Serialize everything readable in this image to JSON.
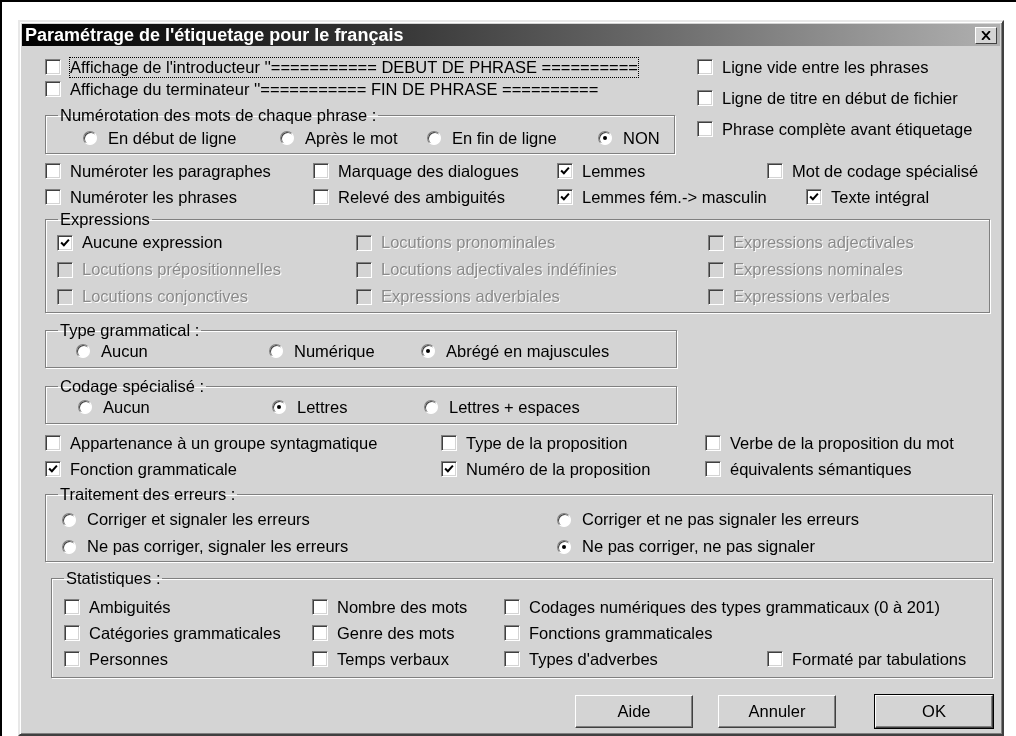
{
  "window": {
    "title": "Paramétrage de l'étiquetage pour le français"
  },
  "display_options": [
    {
      "label": "Affichage de l'introducteur ''=========== DEBUT DE PHRASE ==========",
      "checked": false,
      "focused": true
    },
    {
      "label": "Affichage du terminateur ''=========== FIN DE PHRASE ==========",
      "checked": false,
      "focused": false
    }
  ],
  "word_numbering": {
    "legend": "Numérotation des mots de chaque phrase :",
    "options": [
      {
        "label": "En début de ligne",
        "selected": false
      },
      {
        "label": "Après le mot",
        "selected": false
      },
      {
        "label": "En fin de ligne",
        "selected": false
      },
      {
        "label": "NON",
        "selected": true
      }
    ]
  },
  "file_options": [
    {
      "label": "Ligne vide entre les phrases",
      "checked": false
    },
    {
      "label": "Ligne de titre en début de fichier",
      "checked": false
    },
    {
      "label": "Phrase complète avant étiquetage",
      "checked": false
    }
  ],
  "flags": [
    [
      {
        "label": "Numéroter les paragraphes",
        "checked": false
      },
      {
        "label": "Marquage des dialogues",
        "checked": false
      },
      {
        "label": "Lemmes",
        "checked": true
      },
      {
        "label": "Mot de codage spécialisé",
        "checked": false
      }
    ],
    [
      {
        "label": "Numéroter les phrases",
        "checked": false
      },
      {
        "label": "Relevé des ambiguités",
        "checked": false
      },
      {
        "label": "Lemmes fém.-> masculin",
        "checked": true
      },
      {
        "label": "Texte intégral",
        "checked": true
      }
    ]
  ],
  "expressions": {
    "legend": "Expressions",
    "rows": [
      [
        {
          "label": "Aucune expression",
          "checked": true,
          "disabled": false
        },
        {
          "label": "Locutions pronominales",
          "checked": false,
          "disabled": true
        },
        {
          "label": "Expressions adjectivales",
          "checked": false,
          "disabled": true
        }
      ],
      [
        {
          "label": "Locutions prépositionnelles",
          "checked": false,
          "disabled": true
        },
        {
          "label": "Locutions adjectivales indéfinies",
          "checked": false,
          "disabled": true
        },
        {
          "label": "Expressions nominales",
          "checked": false,
          "disabled": true
        }
      ],
      [
        {
          "label": "Locutions conjonctives",
          "checked": false,
          "disabled": true
        },
        {
          "label": "Expressions adverbiales",
          "checked": false,
          "disabled": true
        },
        {
          "label": "Expressions verbales",
          "checked": false,
          "disabled": true
        }
      ]
    ]
  },
  "grammatical_type": {
    "legend": "Type grammatical :",
    "options": [
      {
        "label": "Aucun",
        "selected": false
      },
      {
        "label": "Numérique",
        "selected": false
      },
      {
        "label": "Abrégé en majuscules",
        "selected": true
      }
    ]
  },
  "special_coding": {
    "legend": "Codage spécialisé :",
    "options": [
      {
        "label": "Aucun",
        "selected": false
      },
      {
        "label": "Lettres",
        "selected": true
      },
      {
        "label": "Lettres + espaces",
        "selected": false
      }
    ]
  },
  "details": [
    [
      {
        "label": "Appartenance à un groupe syntagmatique",
        "checked": false
      },
      {
        "label": "Type de la proposition",
        "checked": false
      },
      {
        "label": "Verbe de la proposition du mot",
        "checked": false
      }
    ],
    [
      {
        "label": "Fonction grammaticale",
        "checked": true
      },
      {
        "label": "Numéro de la proposition",
        "checked": true
      },
      {
        "label": "équivalents sémantiques",
        "checked": false
      }
    ]
  ],
  "errors": {
    "legend": "Traitement des erreurs :",
    "options": [
      {
        "label": "Corriger et signaler les erreurs",
        "selected": false
      },
      {
        "label": "Corriger et ne pas signaler les erreurs",
        "selected": false
      },
      {
        "label": "Ne pas corriger, signaler les erreurs",
        "selected": false
      },
      {
        "label": "Ne pas corriger, ne pas signaler",
        "selected": true
      }
    ]
  },
  "statistics": {
    "legend": "Statistiques :",
    "rows": [
      [
        {
          "label": "Ambiguités",
          "checked": false
        },
        {
          "label": "Nombre des mots",
          "checked": false
        },
        {
          "label": "Codages numériques des types grammaticaux (0 à 201)",
          "checked": false
        }
      ],
      [
        {
          "label": "Catégories grammaticales",
          "checked": false
        },
        {
          "label": "Genre des mots",
          "checked": false
        },
        {
          "label": "Fonctions grammaticales",
          "checked": false
        }
      ],
      [
        {
          "label": "Personnes",
          "checked": false
        },
        {
          "label": "Temps verbaux",
          "checked": false
        },
        {
          "label": "Types d'adverbes",
          "checked": false
        },
        {
          "label": "Formaté par tabulations",
          "checked": false
        }
      ]
    ]
  },
  "buttons": [
    {
      "label": "Aide",
      "default": false
    },
    {
      "label": "Annuler",
      "default": false
    },
    {
      "label": "OK",
      "default": true
    }
  ]
}
